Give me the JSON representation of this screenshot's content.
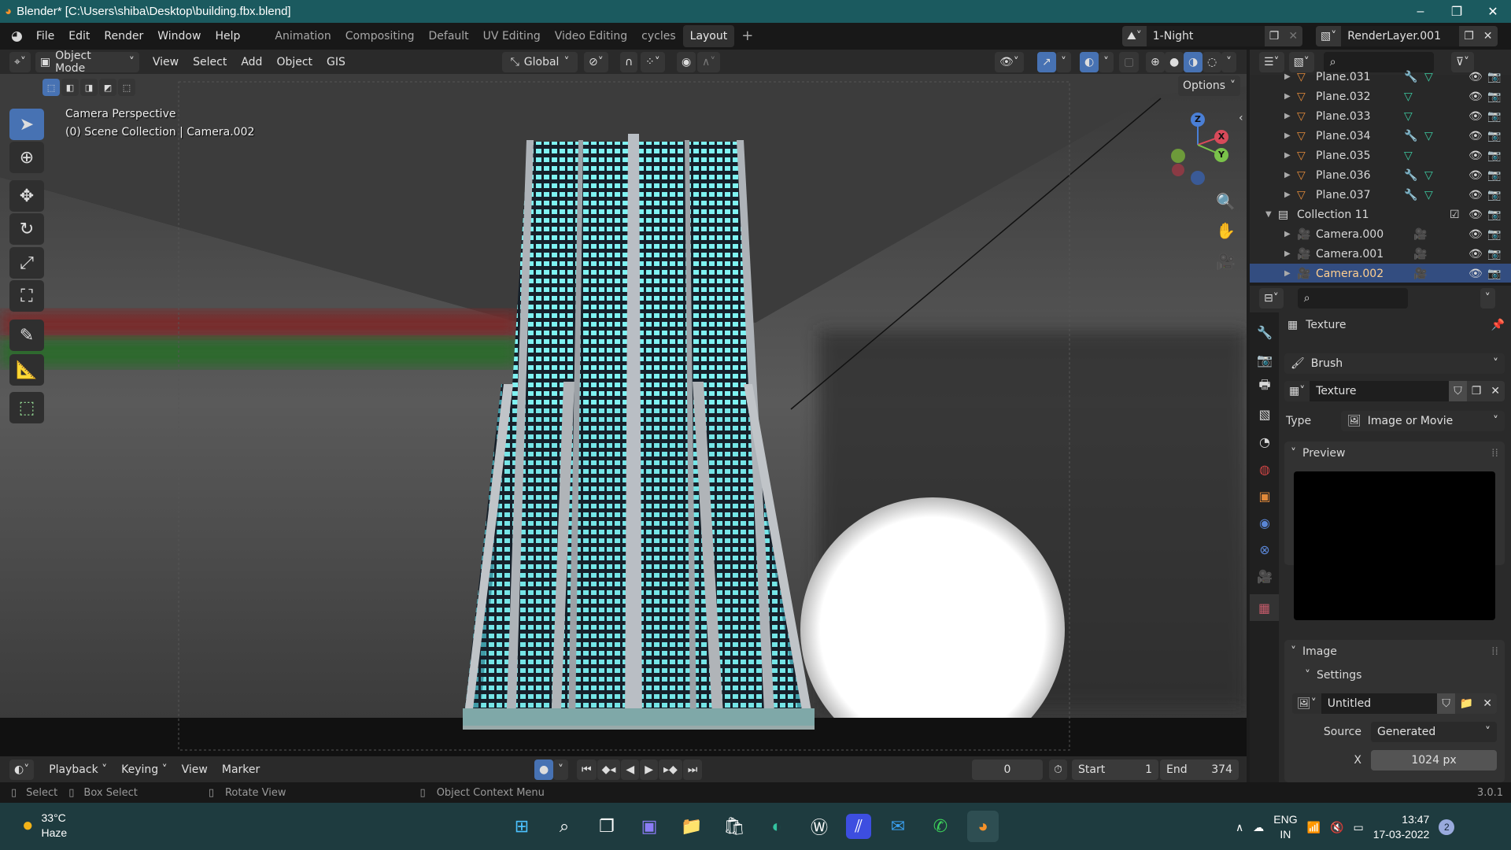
{
  "window": {
    "title": "Blender* [C:\\Users\\shiba\\Desktop\\building.fbx.blend]",
    "minimize": "–",
    "maximize": "❐",
    "close": "✕"
  },
  "menu": {
    "items": [
      "File",
      "Edit",
      "Render",
      "Window",
      "Help"
    ],
    "workspaces": [
      "Animation",
      "Compositing",
      "Default",
      "UV Editing",
      "Video Editing",
      "cycles",
      "Layout"
    ],
    "active_workspace": "Layout",
    "add_tab": "+",
    "scene": "1-Night",
    "view_layer": "RenderLayer.001"
  },
  "viewport_header": {
    "mode": "Object Mode",
    "menus": [
      "View",
      "Select",
      "Add",
      "Object",
      "GIS"
    ],
    "orientation": "Global",
    "options": "Options"
  },
  "viewport": {
    "overlay_line1": "Camera Perspective",
    "overlay_line2": "(0) Scene Collection | Camera.002",
    "gizmo": {
      "x": "X",
      "y": "Y",
      "z": "Z"
    }
  },
  "colors": {
    "accent": "#4772b3",
    "selection": "#334d80",
    "object_orange": "#e0893a",
    "data_green": "#3cc9a0",
    "window_cyan": "#7ff2f2",
    "titlebar": "#1b5a5f"
  },
  "outliner": {
    "rows": [
      {
        "name": "Plane.031",
        "type": "mesh",
        "modifier": true
      },
      {
        "name": "Plane.032",
        "type": "mesh",
        "modifier": false
      },
      {
        "name": "Plane.033",
        "type": "mesh",
        "modifier": false
      },
      {
        "name": "Plane.034",
        "type": "mesh",
        "modifier": true
      },
      {
        "name": "Plane.035",
        "type": "mesh",
        "modifier": false
      },
      {
        "name": "Plane.036",
        "type": "mesh",
        "modifier": true
      },
      {
        "name": "Plane.037",
        "type": "mesh",
        "modifier": true
      },
      {
        "name": "Collection 11",
        "type": "collection"
      },
      {
        "name": "Camera.000",
        "type": "camera"
      },
      {
        "name": "Camera.001",
        "type": "camera"
      },
      {
        "name": "Camera.002",
        "type": "camera",
        "selected": true
      }
    ]
  },
  "properties": {
    "context": "Texture",
    "brush": "Brush",
    "texture_name": "Texture",
    "type_label": "Type",
    "type_value": "Image or Movie",
    "preview_label": "Preview",
    "image_label": "Image",
    "settings_label": "Settings",
    "image_name": "Untitled",
    "source_label": "Source",
    "source_value": "Generated",
    "x_label": "X",
    "x_value": "1024 px"
  },
  "timeline": {
    "menus": [
      "Playback",
      "Keying",
      "View",
      "Marker"
    ],
    "current_frame": "0",
    "start_label": "Start",
    "start": "1",
    "end_label": "End",
    "end": "374"
  },
  "statusbar": {
    "select": "Select",
    "box_select": "Box Select",
    "rotate_view": "Rotate View",
    "context_menu": "Object Context Menu",
    "version": "3.0.1"
  },
  "taskbar": {
    "temperature": "33°C",
    "weather": "Haze",
    "lang1": "ENG",
    "lang2": "IN",
    "time": "13:47",
    "date": "17-03-2022",
    "notifications": "2"
  }
}
